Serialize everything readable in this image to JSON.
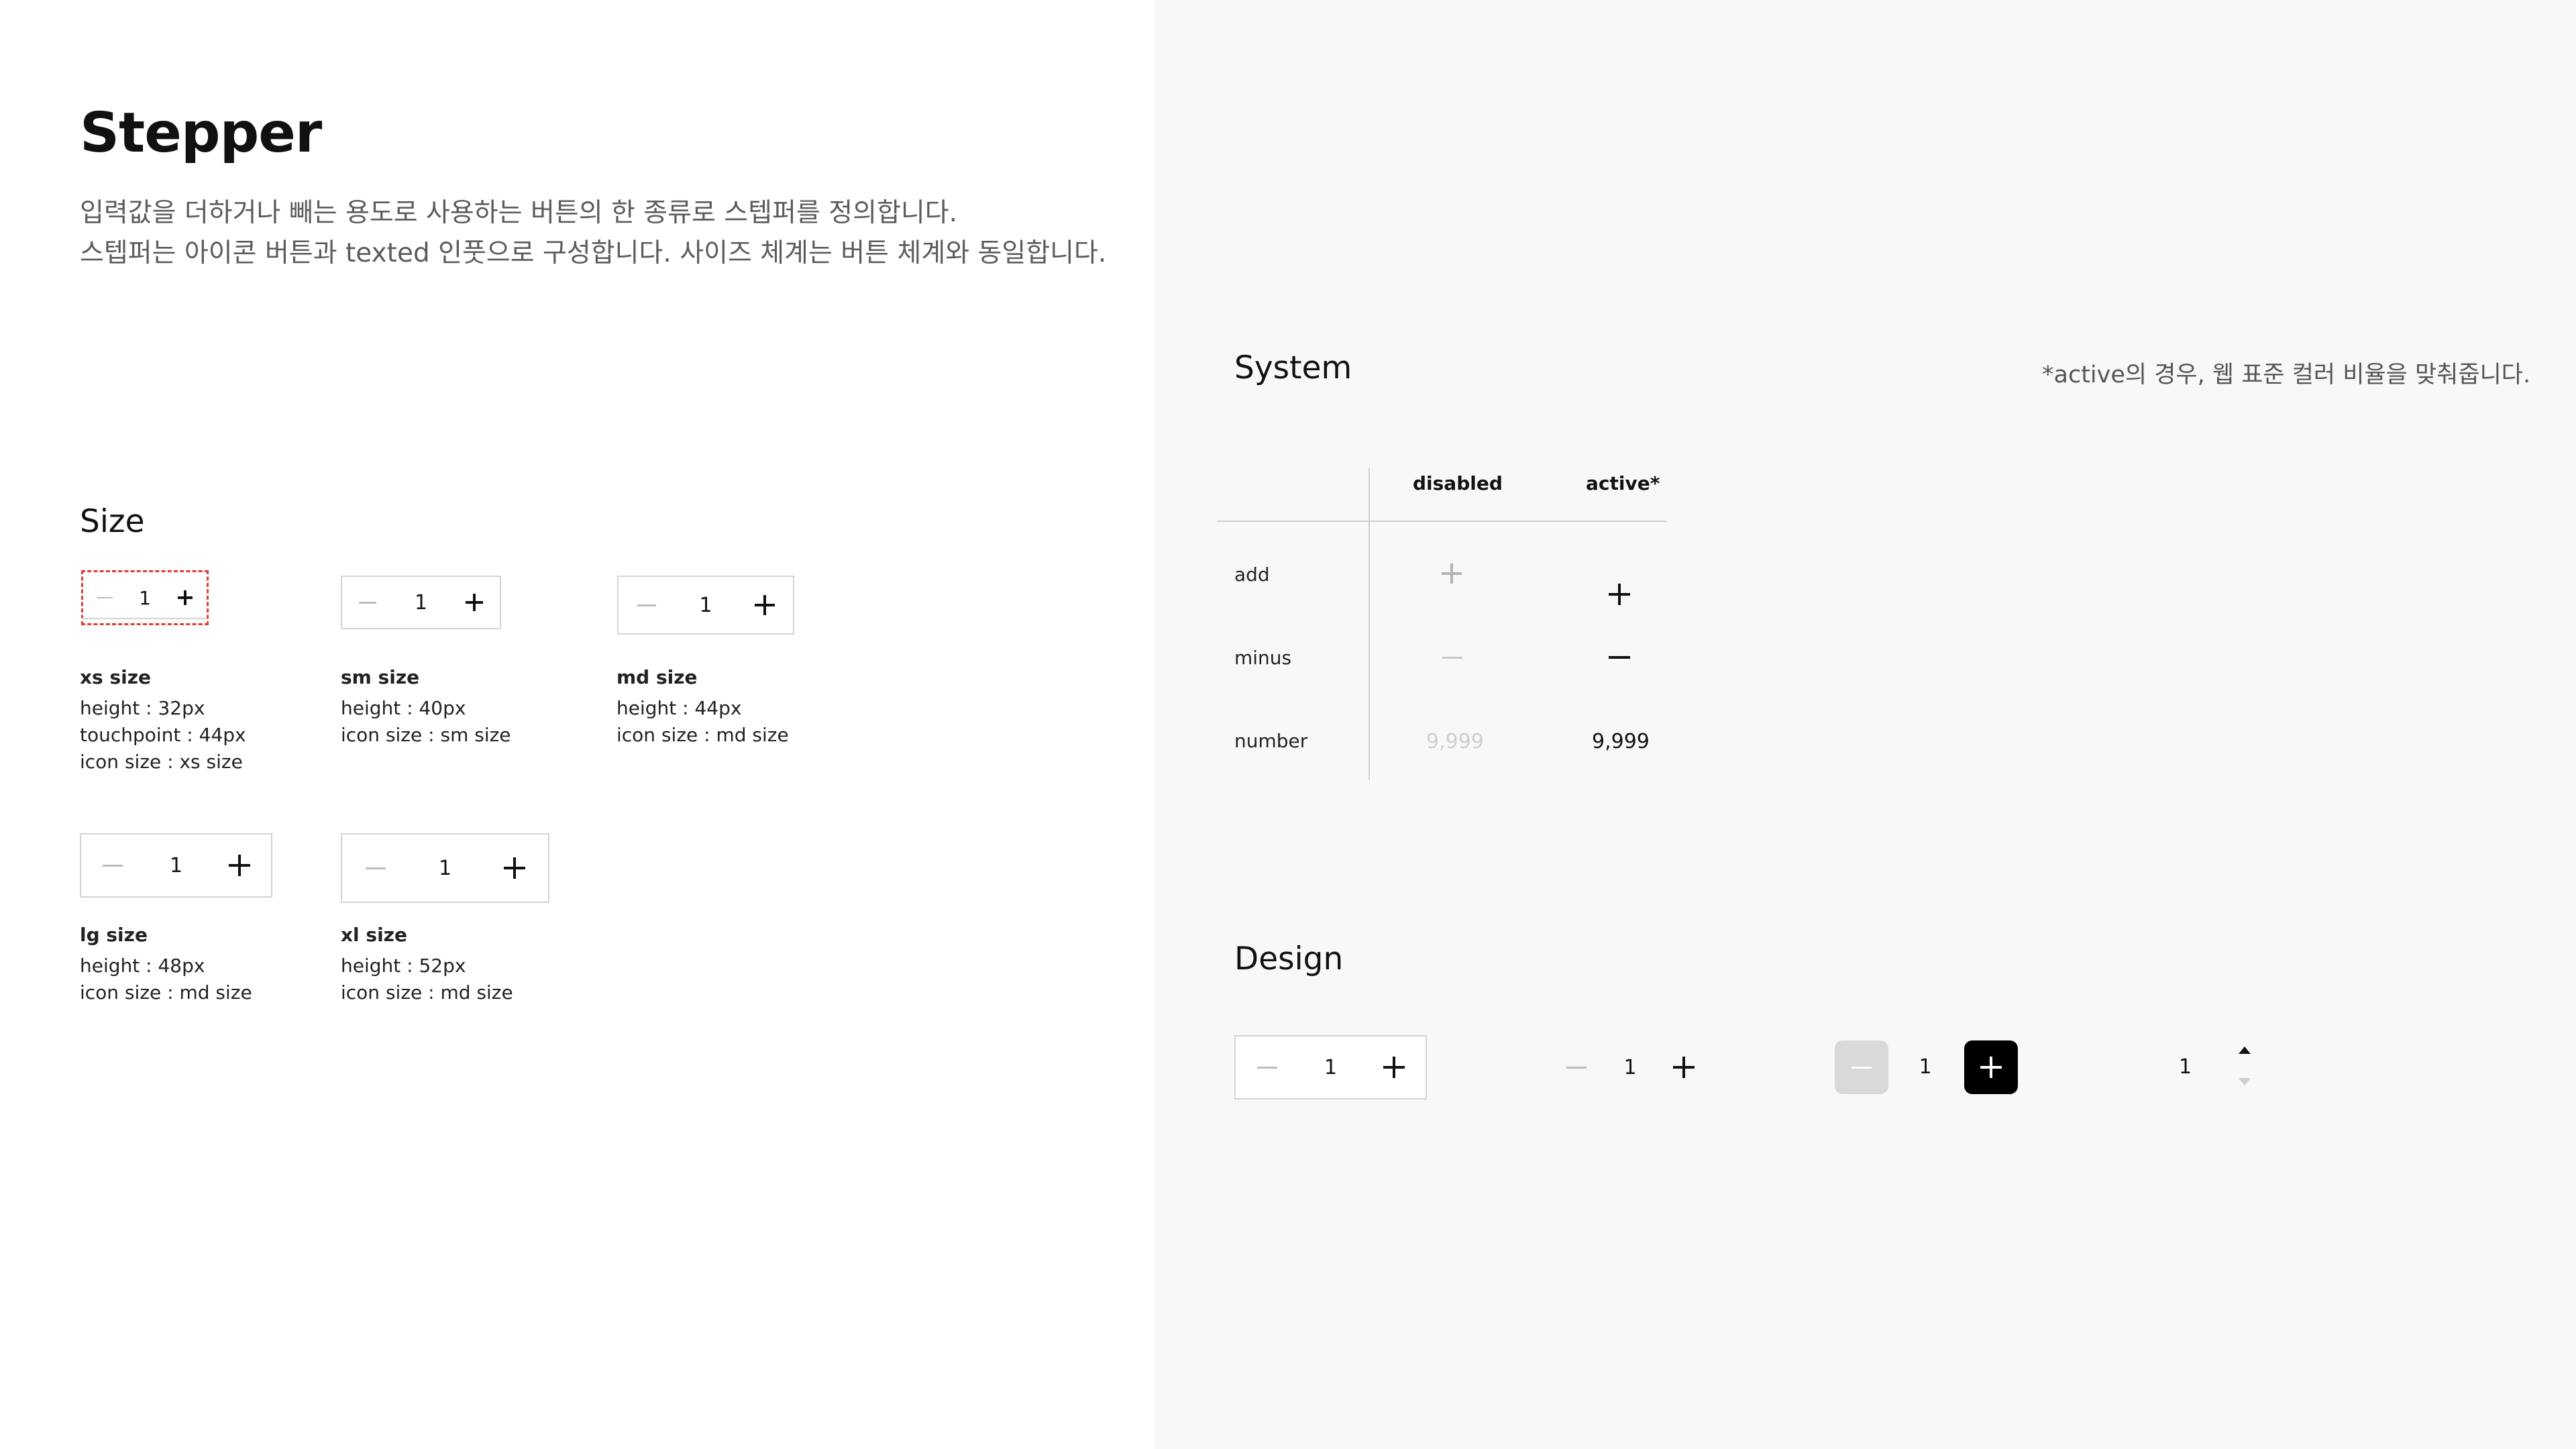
{
  "header": {
    "title": "Stepper",
    "description_lines": [
      "입력값을 더하거나 빼는 용도로 사용하는 버튼의 한 종류로 스텝퍼를 정의합니다.",
      "스텝퍼는 아이콘 버튼과 texted 인풋으로 구성합니다. 사이즈 체계는 버튼 체계와 동일합니다."
    ]
  },
  "size_section": {
    "title": "Size",
    "items": [
      {
        "name": "xs size",
        "value": "1",
        "specs": [
          "height : 32px",
          "touchpoint : 44px",
          "icon size : xs size"
        ]
      },
      {
        "name": "sm size",
        "value": "1",
        "specs": [
          "height : 40px",
          "icon size : sm size"
        ]
      },
      {
        "name": "md size",
        "value": "1",
        "specs": [
          "height : 44px",
          "icon size : md size"
        ]
      },
      {
        "name": "lg size",
        "value": "1",
        "specs": [
          "height : 48px",
          "icon size : md size"
        ]
      },
      {
        "name": "xl size",
        "value": "1",
        "specs": [
          "height : 52px",
          "icon size : md size"
        ]
      }
    ]
  },
  "system_section": {
    "title": "System",
    "note": "*active의 경우, 웹 표준 컬러 비율을 맞춰줍니다.",
    "columns": [
      "disabled",
      "active*"
    ],
    "rows": [
      "add",
      "minus",
      "number"
    ],
    "number_value": "9,999"
  },
  "design_section": {
    "title": "Design",
    "variants": [
      {
        "style": "outlined",
        "value": "1"
      },
      {
        "style": "plain",
        "value": "1"
      },
      {
        "style": "filled",
        "value": "1"
      },
      {
        "style": "spinner",
        "value": "1"
      }
    ]
  },
  "colors": {
    "text_primary": "#111111",
    "text_secondary": "#5c5c5c",
    "disabled": "#bdbdbd",
    "border": "#d4d4d4",
    "panel_bg": "#f8f8f8",
    "highlight_dashed": "#e53935",
    "filled_active": "#000000",
    "filled_disabled": "#d9d9d9"
  },
  "icons": [
    "minus-icon",
    "plus-icon",
    "caret-up-icon",
    "caret-down-icon"
  ]
}
